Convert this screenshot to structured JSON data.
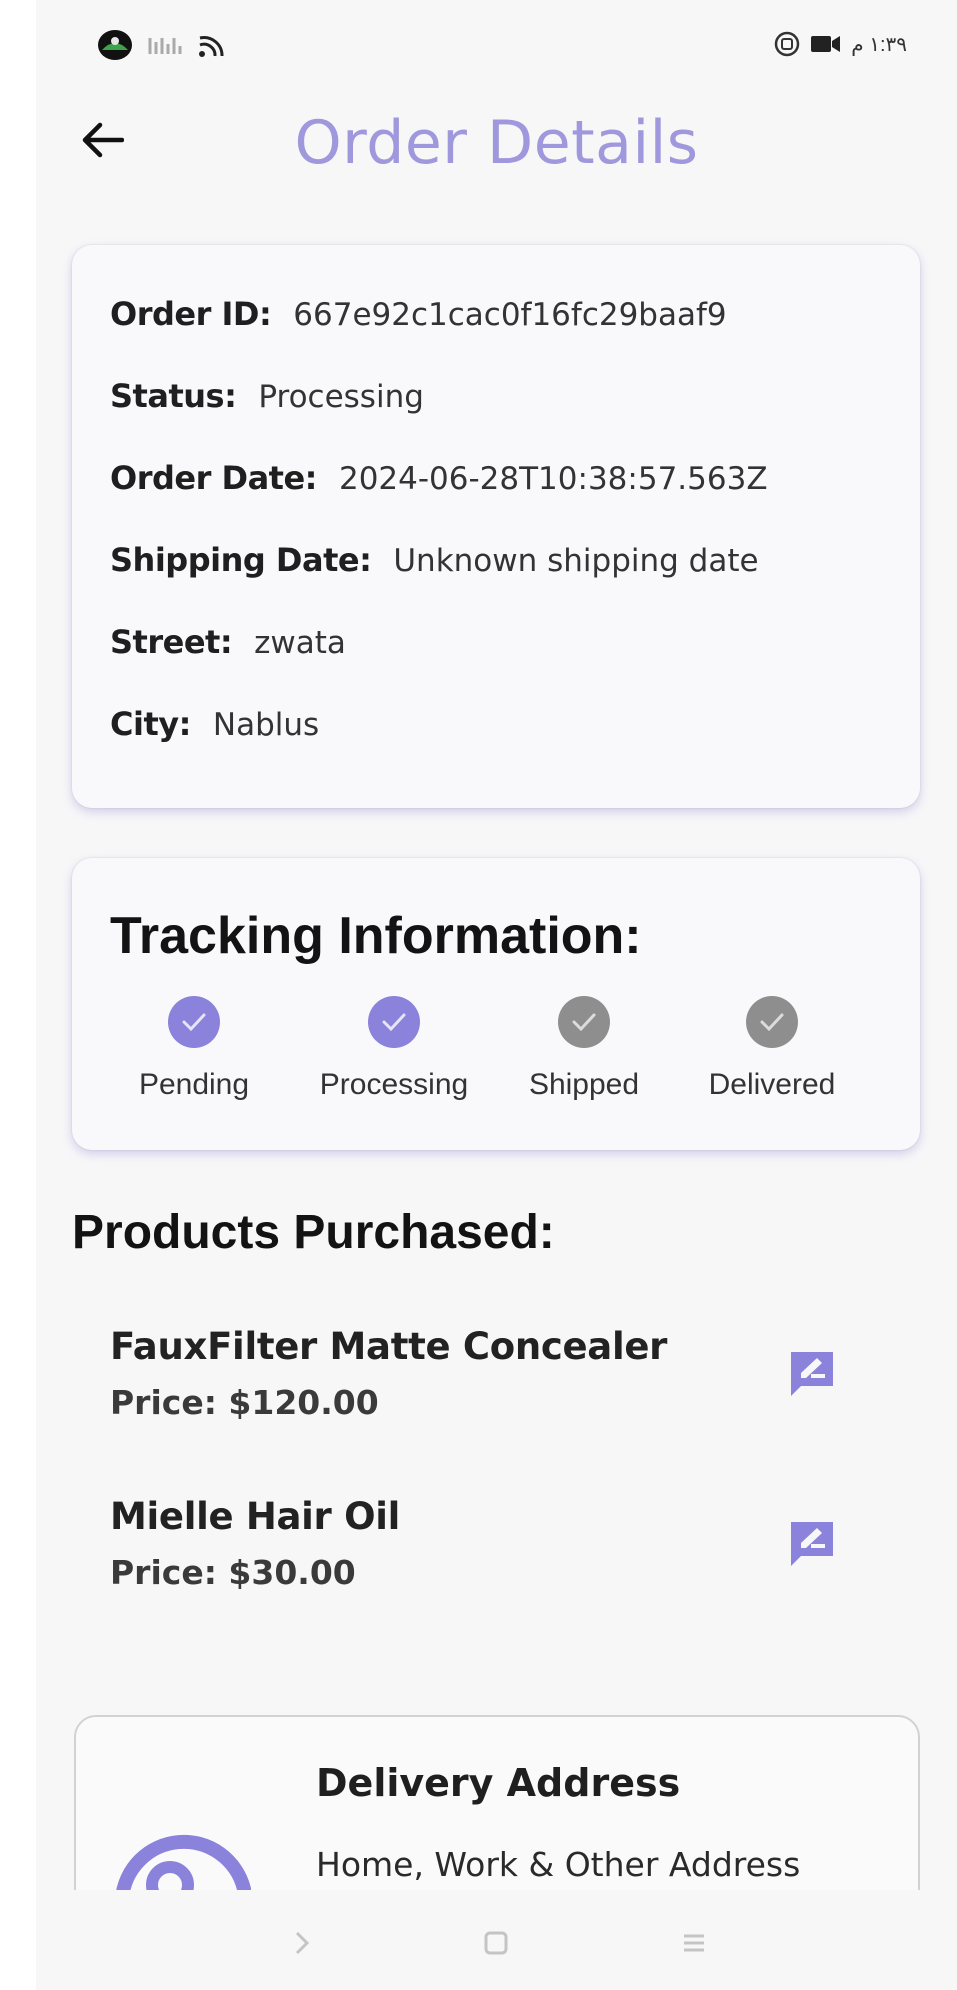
{
  "status_bar": {
    "time": "١:٣٩ م"
  },
  "header": {
    "title": "Order Details"
  },
  "order": {
    "id_label": "Order ID:",
    "id_value": "667e92c1cac0f16fc29baaf9",
    "status_label": "Status:",
    "status_value": "Processing",
    "order_date_label": "Order Date:",
    "order_date_value": "2024-06-28T10:38:57.563Z",
    "shipping_date_label": "Shipping Date:",
    "shipping_date_value": "Unknown shipping date",
    "street_label": "Street:",
    "street_value": "zwata",
    "city_label": "City:",
    "city_value": "Nablus"
  },
  "tracking": {
    "title": "Tracking Information:",
    "steps": [
      {
        "label": "Pending",
        "completed": true
      },
      {
        "label": "Processing",
        "completed": true
      },
      {
        "label": "Shipped",
        "completed": false
      },
      {
        "label": "Delivered",
        "completed": false
      }
    ]
  },
  "products": {
    "title": "Products Purchased:",
    "items": [
      {
        "name": "FauxFilter Matte Concealer",
        "price": "Price: $120.00"
      },
      {
        "name": "Mielle Hair Oil",
        "price": "Price: $30.00"
      }
    ]
  },
  "delivery": {
    "title": "Delivery Address",
    "subtitle": "Home, Work & Other Address"
  },
  "colors": {
    "accent": "#8a82db",
    "title": "#9f98dc",
    "pending_step": "#8e8e8e"
  },
  "icons": {
    "back": "arrow-left-icon",
    "edit": "rate-review-icon",
    "step_done": "check-circle-icon",
    "address": "location-search-icon"
  }
}
